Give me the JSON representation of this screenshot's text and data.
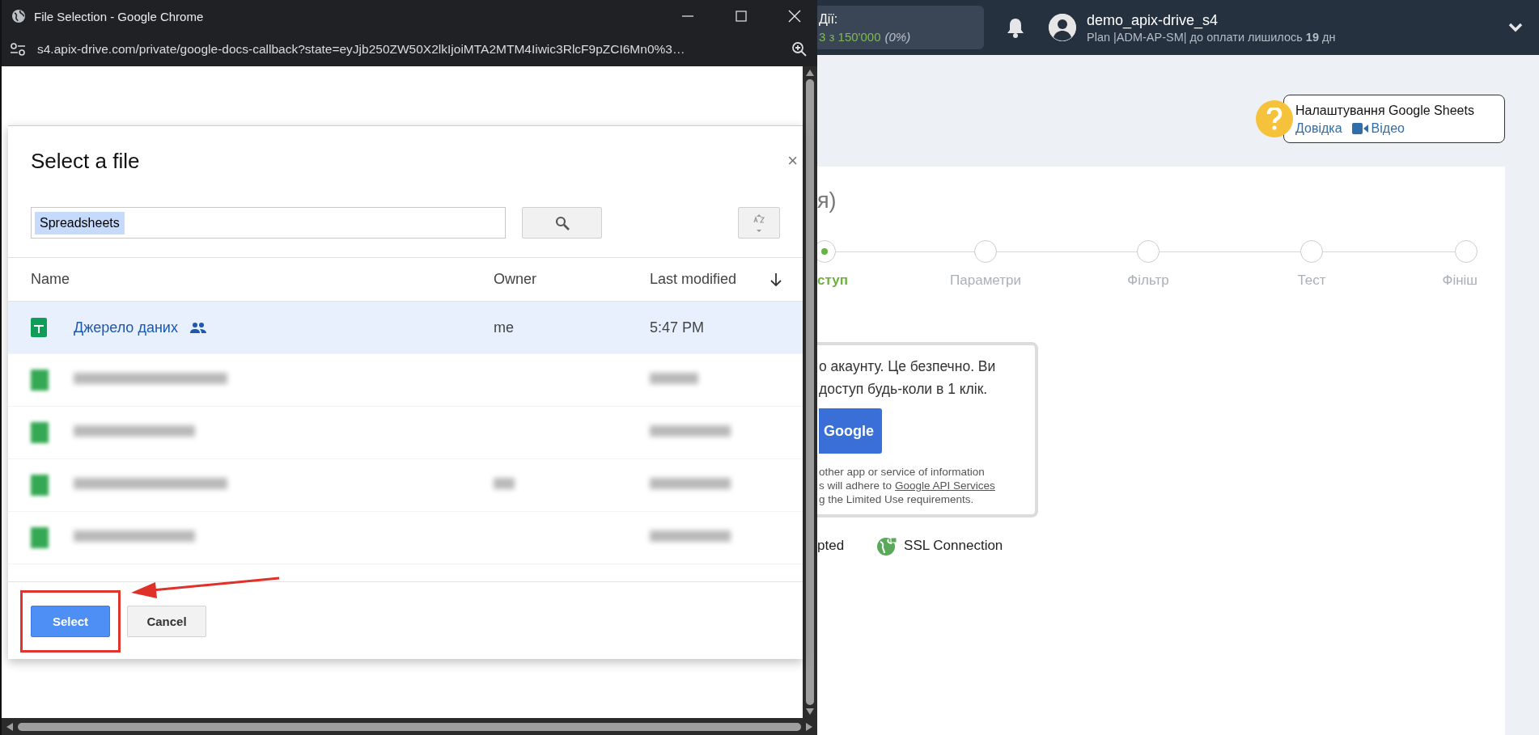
{
  "popup": {
    "title": "File Selection - Google Chrome",
    "url": "s4.apix-drive.com/private/google-docs-callback?state=eyJjb250ZW50X2lkIjoiMTA2MTM4Iiwic3RlcF9pZCI6Mn0%3…",
    "picker": {
      "title": "Select a file",
      "close": "×",
      "search_value": "Spreadsheets",
      "columns": [
        "Name",
        "Owner",
        "Last modified"
      ],
      "rows": [
        {
          "kind": "file",
          "name": "Джерело даних",
          "shared": true,
          "owner": "me",
          "modified": "5:47 PM",
          "selected": true
        },
        {
          "kind": "blurred",
          "owner_shown": false,
          "selected": false
        },
        {
          "kind": "blurred",
          "owner_shown": false,
          "selected": false
        },
        {
          "kind": "blurred",
          "owner_shown": true,
          "selected": false
        },
        {
          "kind": "blurred",
          "owner_shown": false,
          "selected": false
        }
      ],
      "buttons": [
        {
          "label": "Select",
          "primary": true,
          "highlighted": true
        },
        {
          "label": "Cancel",
          "primary": false,
          "highlighted": false
        }
      ]
    }
  },
  "header": {
    "actions_label": "Дії:",
    "actions_count": "3 з 150'000",
    "actions_pct": "(0%)",
    "user": "demo_apix-drive_s4",
    "plan": "Plan |ADM-AP-SM| до оплати лишилось **19** дн"
  },
  "help": {
    "title": "Налаштування Google Sheets",
    "links": [
      "Довідка",
      "Відео"
    ]
  },
  "card": {
    "title": "я)",
    "steps": [
      {
        "label": "ступ",
        "selected": true
      },
      {
        "label": "Параметри",
        "selected": false
      },
      {
        "label": "Фільтр",
        "selected": false
      },
      {
        "label": "Тест",
        "selected": false
      },
      {
        "label": "Фініш",
        "selected": false
      }
    ],
    "auth": {
      "lines": [
        "о акаунту. Це безпечно. Ви",
        "доступ будь-коли в 1 клік."
      ],
      "button": "Google",
      "disclaimer": [
        {
          "text": "other app or service of information"
        },
        {
          "text": "s will adhere to",
          "link": "Google API Services"
        },
        {
          "text": "g the Limited Use requirements."
        }
      ]
    },
    "badges": [
      "pted",
      "SSL Connection"
    ]
  }
}
